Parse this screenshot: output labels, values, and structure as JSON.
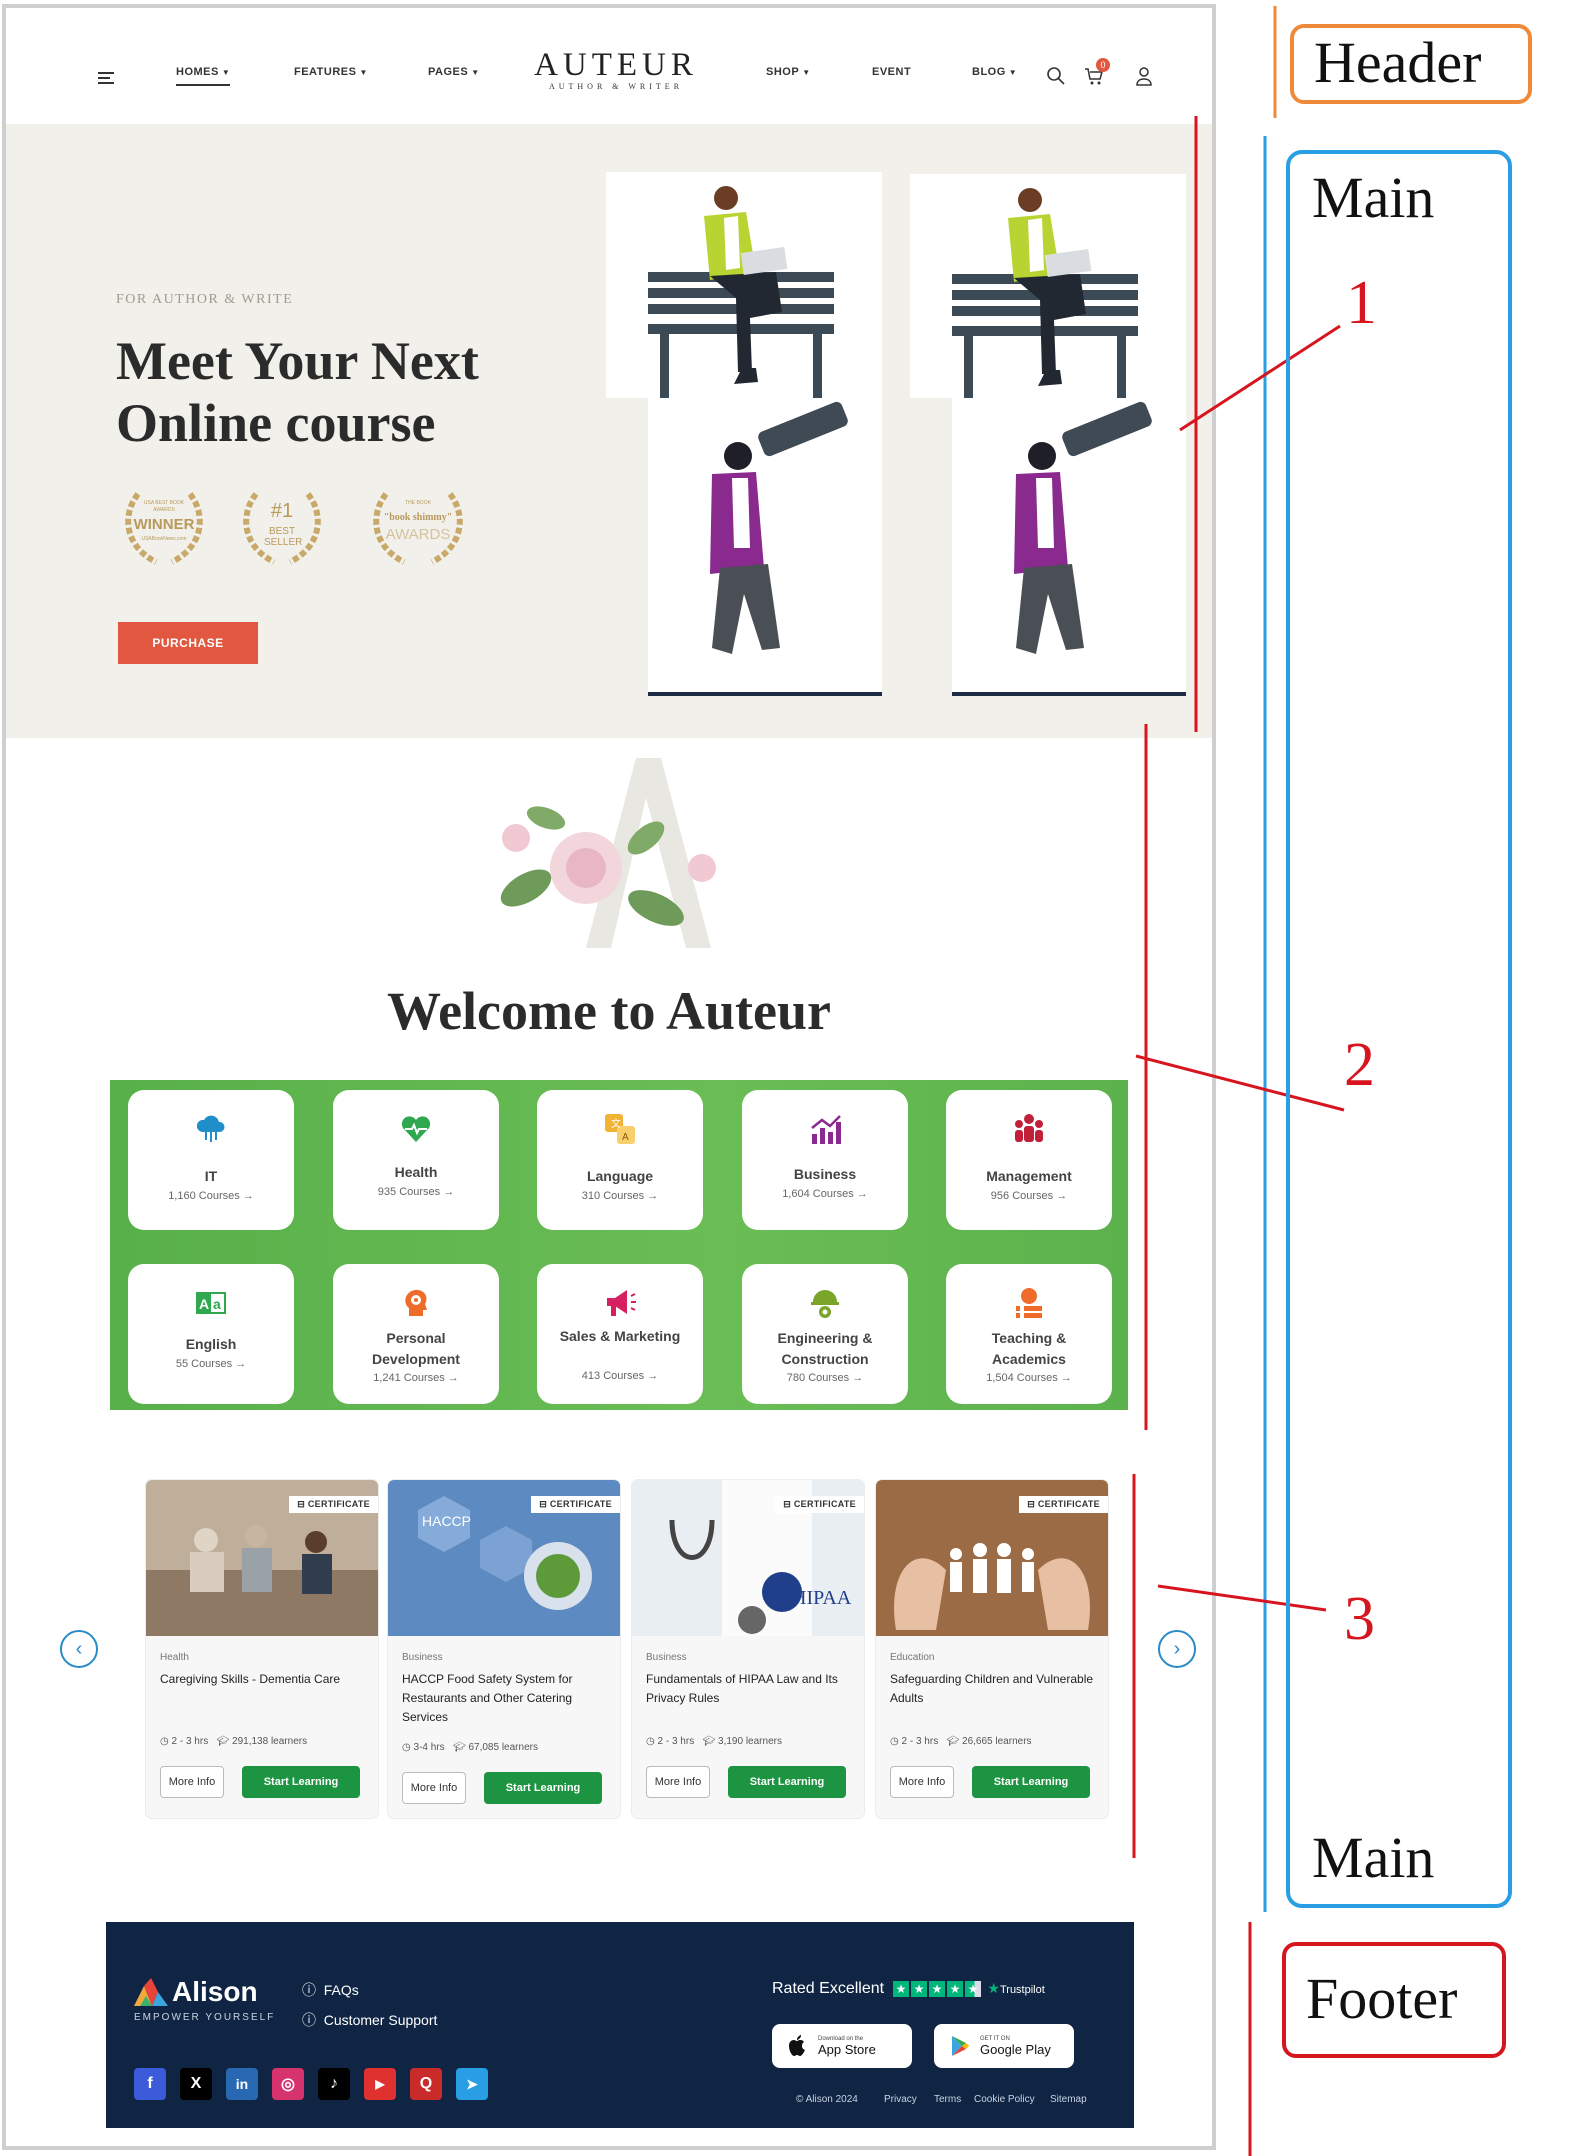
{
  "header": {
    "nav_left": [
      {
        "label": "HOMES",
        "caret": true,
        "active": true
      },
      {
        "label": "FEATURES",
        "caret": true
      },
      {
        "label": "PAGES",
        "caret": true
      }
    ],
    "nav_right": [
      {
        "label": "SHOP",
        "caret": true
      },
      {
        "label": "EVENT",
        "caret": false
      },
      {
        "label": "BLOG",
        "caret": true
      }
    ],
    "logo_title": "AUTEUR",
    "logo_subtitle": "AUTHOR & WRITER",
    "cart_count": "0"
  },
  "hero": {
    "kicker": "FOR AUTHOR & WRITE",
    "title_line1": "Meet Your Next",
    "title_line2": "Online course",
    "awards": [
      {
        "line1": "USA BEST BOOK",
        "line2": "AWARDS",
        "big": "WINNER",
        "line3": "USABookNews.com"
      },
      {
        "line1": "",
        "line2": "",
        "big": "#1",
        "line3": "BEST SELLER"
      },
      {
        "line1": "",
        "line2": "THE BOOK",
        "big": "\"book shimmy\"",
        "line3": "AWARDS"
      }
    ],
    "purchase_label": "PURCHASE"
  },
  "welcome": {
    "title": "Welcome to Auteur",
    "categories": [
      {
        "name": "IT",
        "count": "1,160 Courses",
        "icon": "cloud-network-icon",
        "color": "#1f8ec9"
      },
      {
        "name": "Health",
        "count": "935 Courses",
        "icon": "heart-pulse-icon",
        "color": "#2fa84f"
      },
      {
        "name": "Language",
        "count": "310 Courses",
        "icon": "translate-icon",
        "color": "#f2b233"
      },
      {
        "name": "Business",
        "count": "1,604 Courses",
        "icon": "chart-up-icon",
        "color": "#8a2a8e"
      },
      {
        "name": "Management",
        "count": "956 Courses",
        "icon": "team-icon",
        "color": "#c0203a"
      },
      {
        "name": "English",
        "count": "55 Courses",
        "icon": "alphabet-icon",
        "color": "#2fa84f"
      },
      {
        "name": "Personal Development",
        "count": "1,241 Courses",
        "icon": "head-gear-icon",
        "color": "#ef6b2a"
      },
      {
        "name": "Sales & Marketing",
        "count": "413 Courses",
        "icon": "megaphone-icon",
        "color": "#d6205f"
      },
      {
        "name": "Engineering & Construction",
        "count": "780 Courses",
        "icon": "helmet-gear-icon",
        "color": "#7aa52a"
      },
      {
        "name": "Teaching & Academics",
        "count": "1,504 Courses",
        "icon": "apple-books-icon",
        "color": "#ef6b2a"
      }
    ]
  },
  "courses": {
    "certificate_label": "CERTIFICATE",
    "more_info_label": "More Info",
    "start_label": "Start Learning",
    "items": [
      {
        "category": "Health",
        "title": "Caregiving Skills - Dementia Care",
        "duration": "2 - 3 hrs",
        "learners": "291,138 learners"
      },
      {
        "category": "Business",
        "title": "HACCP Food Safety System for Restaurants and Other Catering Services",
        "duration": "3-4 hrs",
        "learners": "67,085 learners",
        "img_text": "HACCP"
      },
      {
        "category": "Business",
        "title": "Fundamentals of HIPAA Law and Its Privacy Rules",
        "duration": "2 - 3 hrs",
        "learners": "3,190 learners",
        "img_text": "HIPAA"
      },
      {
        "category": "Education",
        "title": "Safeguarding Children and Vulnerable Adults",
        "duration": "2 - 3 hrs",
        "learners": "26,665 learners"
      }
    ]
  },
  "footer": {
    "brand": "Alison",
    "tagline": "EMPOWER YOURSELF",
    "links": [
      "FAQs",
      "Customer Support"
    ],
    "rated": "Rated Excellent",
    "trustpilot": "Trustpilot",
    "app_store_small": "Download on the",
    "app_store": "App Store",
    "google_small": "GET IT ON",
    "google_play": "Google Play",
    "legal": [
      "© Alison 2024",
      "Privacy",
      "Terms",
      "Cookie Policy",
      "Sitemap"
    ],
    "social": [
      {
        "icon": "facebook-icon",
        "glyph": "f",
        "color": "#3b5bdb"
      },
      {
        "icon": "x-icon",
        "glyph": "X",
        "color": "#000000"
      },
      {
        "icon": "linkedin-icon",
        "glyph": "in",
        "color": "#2867b2"
      },
      {
        "icon": "instagram-icon",
        "glyph": "◎",
        "color": "#d6336c"
      },
      {
        "icon": "tiktok-icon",
        "glyph": "♪",
        "color": "#000000"
      },
      {
        "icon": "youtube-icon",
        "glyph": "▶",
        "color": "#e03131"
      },
      {
        "icon": "quora-icon",
        "glyph": "Q",
        "color": "#c92a2a"
      },
      {
        "icon": "telegram-icon",
        "glyph": "➤",
        "color": "#2a9ee5"
      }
    ]
  },
  "annotations": {
    "header_label": "Header",
    "main_label": "Main",
    "footer_label": "Footer",
    "num1": "1",
    "num2": "2",
    "num3": "3"
  }
}
